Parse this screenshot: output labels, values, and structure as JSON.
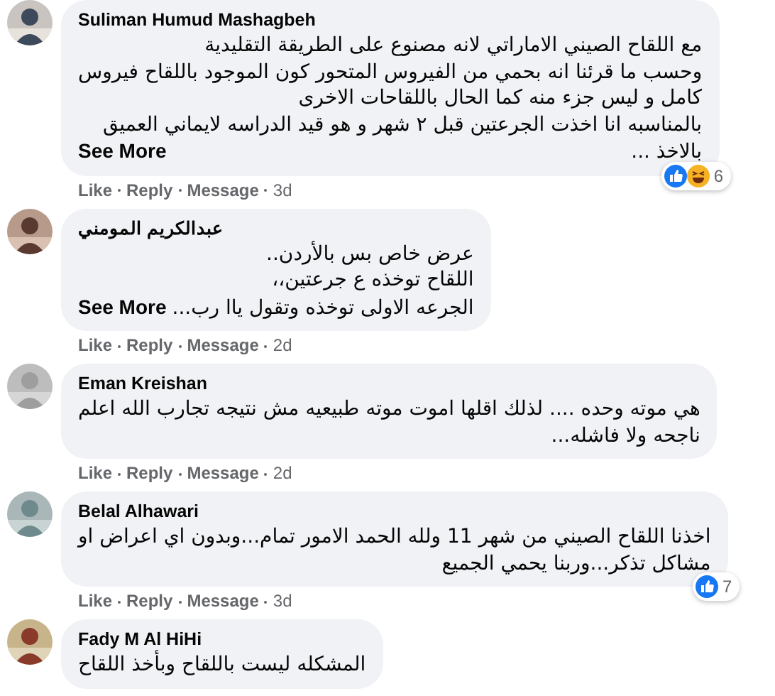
{
  "comments": [
    {
      "author": "Suliman Humud Mashagbeh",
      "lines": [
        "مع اللقاح الصيني الاماراتي لانه مصنوع على الطريقة التقليدية",
        "وحسب ما قرئنا انه بحمي من الفيروس المتحور كون الموجود باللقاح فيروس",
        "كامل و ليس جزء منه كما الحال باللقاحات الاخرى",
        "بالمناسبه انا اخذت الجرعتين قبل ٢ شهر و هو قيد الدراسه لايماني العميق",
        "بالاخذ ..."
      ],
      "see_more": "See More",
      "actions": {
        "like": "Like",
        "reply": "Reply",
        "message": "Message"
      },
      "time": "3d",
      "reactions": {
        "icons": [
          {
            "kind": "like"
          },
          {
            "kind": "haha"
          }
        ],
        "count": "6"
      }
    },
    {
      "author": "عبدالكريم المومني",
      "lines": [
        "عرض خاص بس بالأردن..",
        "اللقاح توخذه ع جرعتين،،",
        "الجرعه الاولى توخذه وتقول ياا رب..."
      ],
      "see_more": "See More",
      "actions": {
        "like": "Like",
        "reply": "Reply",
        "message": "Message"
      },
      "time": "2d"
    },
    {
      "author": "Eman Kreishan",
      "lines": [
        "هي موته وحده .... لذلك اقلها اموت موته طبيعيه مش نتيجه تجارب الله اعلم",
        "ناجحه ولا فاشله..."
      ],
      "actions": {
        "like": "Like",
        "reply": "Reply",
        "message": "Message"
      },
      "time": "2d"
    },
    {
      "author": "Belal Alhawari",
      "lines": [
        "اخذنا اللقاح الصيني من شهر 11 ولله الحمد الامور تمام...وبدون اي اعراض او",
        "مشاكل تذكر...وربنا يحمي الجميع"
      ],
      "actions": {
        "like": "Like",
        "reply": "Reply",
        "message": "Message"
      },
      "time": "3d",
      "reactions": {
        "icons": [
          {
            "kind": "like"
          }
        ],
        "count": "7"
      }
    },
    {
      "author": "Fady M Al HiHi",
      "lines": [
        "المشكله ليست باللقاح وبأخذ اللقاح"
      ]
    }
  ]
}
